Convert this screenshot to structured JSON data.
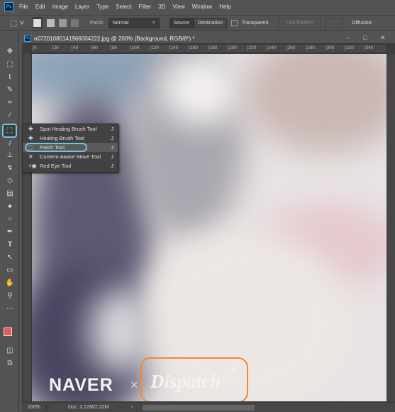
{
  "menubar": {
    "logo": "Ps",
    "items": [
      "File",
      "Edit",
      "Image",
      "Layer",
      "Type",
      "Select",
      "Filter",
      "3D",
      "View",
      "Window",
      "Help"
    ]
  },
  "options": {
    "patch_label": "Patch:",
    "patch_value": "Normal",
    "source": "Source",
    "destination": "Destination",
    "transparent": "Transparent",
    "use_pattern": "Use Pattern",
    "diffusion": "Diffusion:"
  },
  "document": {
    "title": "o07201080141966004222.jpg @ 200% (Background, RGB/8*) *",
    "ruler_ticks": [
      "0",
      "20",
      "40",
      "60",
      "80",
      "100",
      "120",
      "140",
      "160",
      "180",
      "200",
      "220",
      "240",
      "260",
      "280",
      "300",
      "320",
      "340"
    ]
  },
  "flyout": [
    {
      "label": "Spot Healing Brush Tool",
      "key": "J",
      "icon": "spot-healing-brush-icon"
    },
    {
      "label": "Healing Brush Tool",
      "key": "J",
      "icon": "healing-brush-icon"
    },
    {
      "label": "Patch Tool",
      "key": "J",
      "icon": "patch-icon",
      "selected": true
    },
    {
      "label": "Content-Aware Move Tool",
      "key": "J",
      "icon": "content-aware-move-icon"
    },
    {
      "label": "Red Eye Tool",
      "key": "J",
      "icon": "red-eye-icon"
    }
  ],
  "watermark": {
    "naver": "NAVER",
    "x": "×",
    "dispatch": "Dispatch",
    "hd": "HD"
  },
  "status": {
    "zoom": "200%",
    "doc": "Doc: 2.22M/2.22M"
  },
  "colors": {
    "highlight_blue": "#6fc3e8",
    "highlight_orange": "#f08a30",
    "foreground": "#e85a5a"
  }
}
